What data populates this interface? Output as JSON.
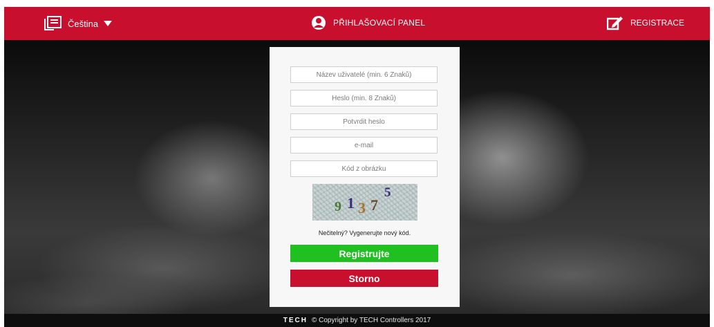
{
  "header": {
    "language": "Čeština",
    "title": "PŘIHLAŠOVACÍ PANEL",
    "register": "REGISTRACE"
  },
  "form": {
    "username_placeholder": "Název uživatelé (min. 6 Znaků)",
    "password_placeholder": "Heslo (min. 8 Znaků)",
    "confirm_placeholder": "Potvrdit heslo",
    "email_placeholder": "e-mail",
    "captcha_placeholder": "Kód z obrázku",
    "captcha_digits": [
      "9",
      "1",
      "3",
      "7",
      "5"
    ],
    "regenerate_text": "Nečitelný? Vygenerujte nový kód.",
    "submit_label": "Registrujte",
    "cancel_label": "Storno"
  },
  "footer": {
    "brand": "TECH",
    "copyright": "© Copyright by TECH Controllers 2017"
  },
  "colors": {
    "brand_red": "#c8102e",
    "submit_green": "#1fc01f"
  },
  "icons": [
    "list-icon",
    "caret-down-icon",
    "user-icon",
    "edit-icon"
  ]
}
